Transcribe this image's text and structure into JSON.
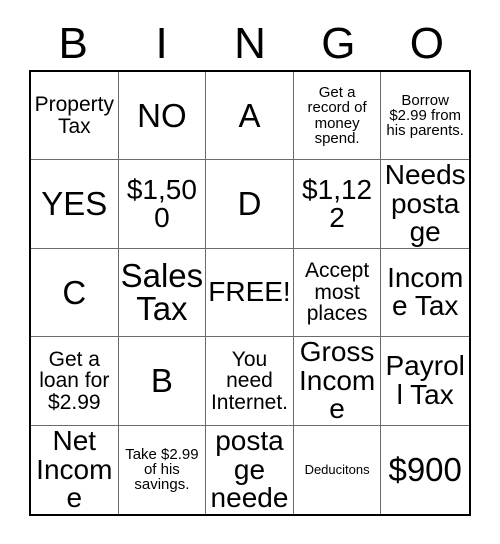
{
  "header": {
    "letters": [
      "B",
      "I",
      "N",
      "G",
      "O"
    ]
  },
  "grid": {
    "rows": 5,
    "columns": 5,
    "free_space_label": "FREE!",
    "cells": [
      {
        "text": "Property Tax",
        "size": "fs-md"
      },
      {
        "text": "NO",
        "size": "fs-xl"
      },
      {
        "text": "A",
        "size": "fs-xl"
      },
      {
        "text": "Get a record of money spend.",
        "size": "fs-sm"
      },
      {
        "text": "Borrow $2.99 from his parents.",
        "size": "fs-sm"
      },
      {
        "text": "YES",
        "size": "fs-xl"
      },
      {
        "text": "$1,500",
        "size": "fs-lg"
      },
      {
        "text": "D",
        "size": "fs-xl"
      },
      {
        "text": "$1,122",
        "size": "fs-lg"
      },
      {
        "text": "Needs postage",
        "size": "fs-lg"
      },
      {
        "text": "C",
        "size": "fs-xl"
      },
      {
        "text": "Sales Tax",
        "size": "fs-xl"
      },
      {
        "text": "FREE!",
        "size": "fs-lg"
      },
      {
        "text": "Accept most places",
        "size": "fs-md"
      },
      {
        "text": "Income Tax",
        "size": "fs-lg"
      },
      {
        "text": "Get a loan for $2.99",
        "size": "fs-md"
      },
      {
        "text": "B",
        "size": "fs-xl"
      },
      {
        "text": "You need Internet.",
        "size": "fs-md"
      },
      {
        "text": "Gross Income",
        "size": "fs-lg"
      },
      {
        "text": "Payroll Tax",
        "size": "fs-lg"
      },
      {
        "text": "Net Income",
        "size": "fs-lg"
      },
      {
        "text": "Take $2.99 of his savings.",
        "size": "fs-sm"
      },
      {
        "text": "No postage needed.",
        "size": "fs-lg"
      },
      {
        "text": "Deducitons",
        "size": "fs-xs"
      },
      {
        "text": "$900",
        "size": "fs-xl"
      }
    ]
  },
  "colors": {
    "background": "#ffffff",
    "text": "#000000",
    "outer_border": "#000000",
    "inner_border": "#6b6b6b"
  }
}
